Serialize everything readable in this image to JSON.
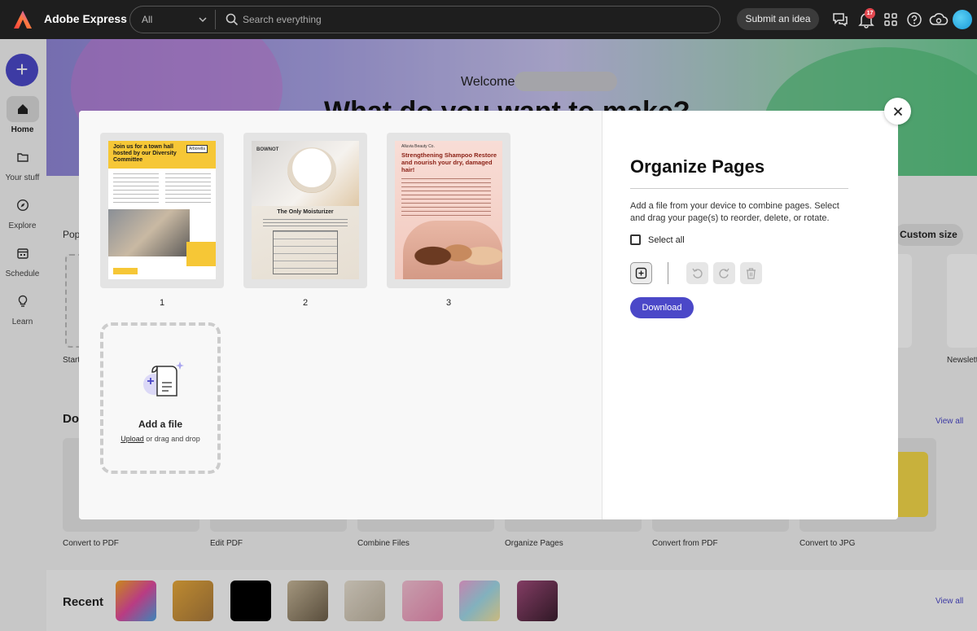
{
  "topbar": {
    "app_title": "Adobe Express",
    "search_scope": "All",
    "search_placeholder": "Search everything",
    "submit_idea_label": "Submit an idea",
    "notification_count": "17",
    "brand_color": "#4b48c8"
  },
  "leftrail": {
    "create_label": "+",
    "items": [
      {
        "label": "Home",
        "icon": "home-icon",
        "active": true
      },
      {
        "label": "Your stuff",
        "icon": "folder-icon"
      },
      {
        "label": "Explore",
        "icon": "compass-icon"
      },
      {
        "label": "Schedule",
        "icon": "calendar-icon"
      },
      {
        "label": "Learn",
        "icon": "lightbulb-icon"
      }
    ]
  },
  "background": {
    "welcome": "Welcome",
    "hero_heading": "What do you want to make?",
    "popular_label": "Pop",
    "custom_size_label": "Custom size",
    "start_label": "Start",
    "newsletter_label": "Newslett",
    "docs_label": "Doc",
    "view_all_label": "View all",
    "quick_actions": [
      "Convert to PDF",
      "Edit PDF",
      "Combine Files",
      "Organize Pages",
      "Convert from PDF",
      "Convert to JPG"
    ],
    "recent_label": "Recent"
  },
  "modal": {
    "pages": [
      {
        "number": "1",
        "headline": "Join us for a town hall hosted by our Diversity Committee",
        "brand": "Arborella"
      },
      {
        "number": "2",
        "headline": "The Only Moisturizer",
        "brand": "BOWNOT"
      },
      {
        "number": "3",
        "headline": "Strengthening Shampoo Restore and nourish your dry, damaged hair!",
        "brand": "Alluvia Beauty Co."
      }
    ],
    "add_file_title": "Add a file",
    "upload_link": "Upload",
    "upload_suffix": " or drag and drop",
    "title": "Organize Pages",
    "description": "Add a file from your device to combine pages. Select and drag your page(s) to reorder, delete, or rotate.",
    "select_all_label": "Select all",
    "download_label": "Download"
  }
}
